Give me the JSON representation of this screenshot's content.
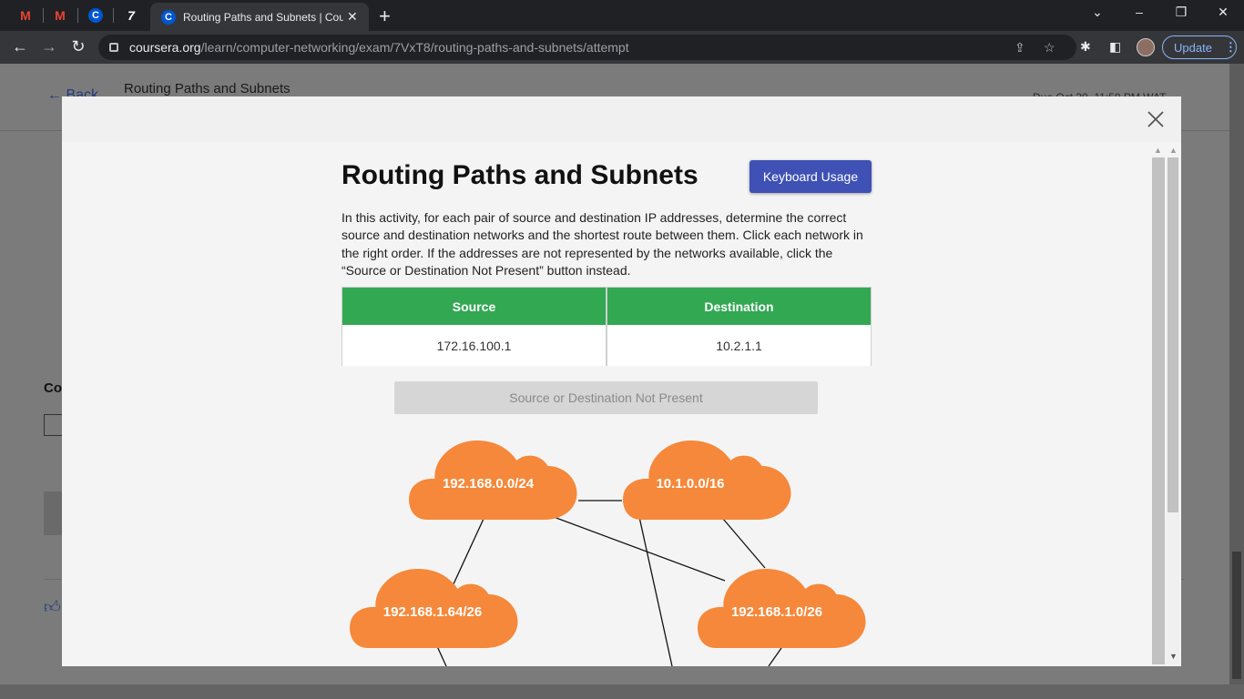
{
  "browser": {
    "tab_title": "Routing Paths and Subnets | Coursera",
    "tab_close": "✕",
    "new_tab": "+",
    "url_host": "coursera.org",
    "url_path": "/learn/computer-networking/exam/7VxT8/routing-paths-and-subnets/attempt",
    "update_label": "Update",
    "pinned_tabs": [
      "gmail-1",
      "gmail-2",
      "coursera",
      "seven"
    ]
  },
  "page": {
    "back_label": "Back",
    "title": "Routing Paths and Subnets",
    "due": "Due Oct 30, 11:59 PM WAT",
    "fragment_label": "Co"
  },
  "modal": {
    "title": "Routing Paths and Subnets",
    "keyboard_button": "Keyboard Usage",
    "instructions": "In this activity, for each pair of source and destination IP addresses, determine the correct source and destination networks and the shortest route between them. Click each network in the right order. If the addresses are not represented by the networks available, click the “Source or Destination Not Present” button instead.",
    "table": {
      "headers": [
        "Source",
        "Destination"
      ],
      "values": [
        "172.16.100.1",
        "10.2.1.1"
      ]
    },
    "not_present_button": "Source or Destination Not Present",
    "networks": [
      "192.168.0.0/24",
      "10.1.0.0/16",
      "192.168.1.64/26",
      "192.168.1.0/26"
    ],
    "colors": {
      "cloud": "#f5883a",
      "header_green": "#33a853",
      "button_blue": "#3f51b5"
    }
  }
}
